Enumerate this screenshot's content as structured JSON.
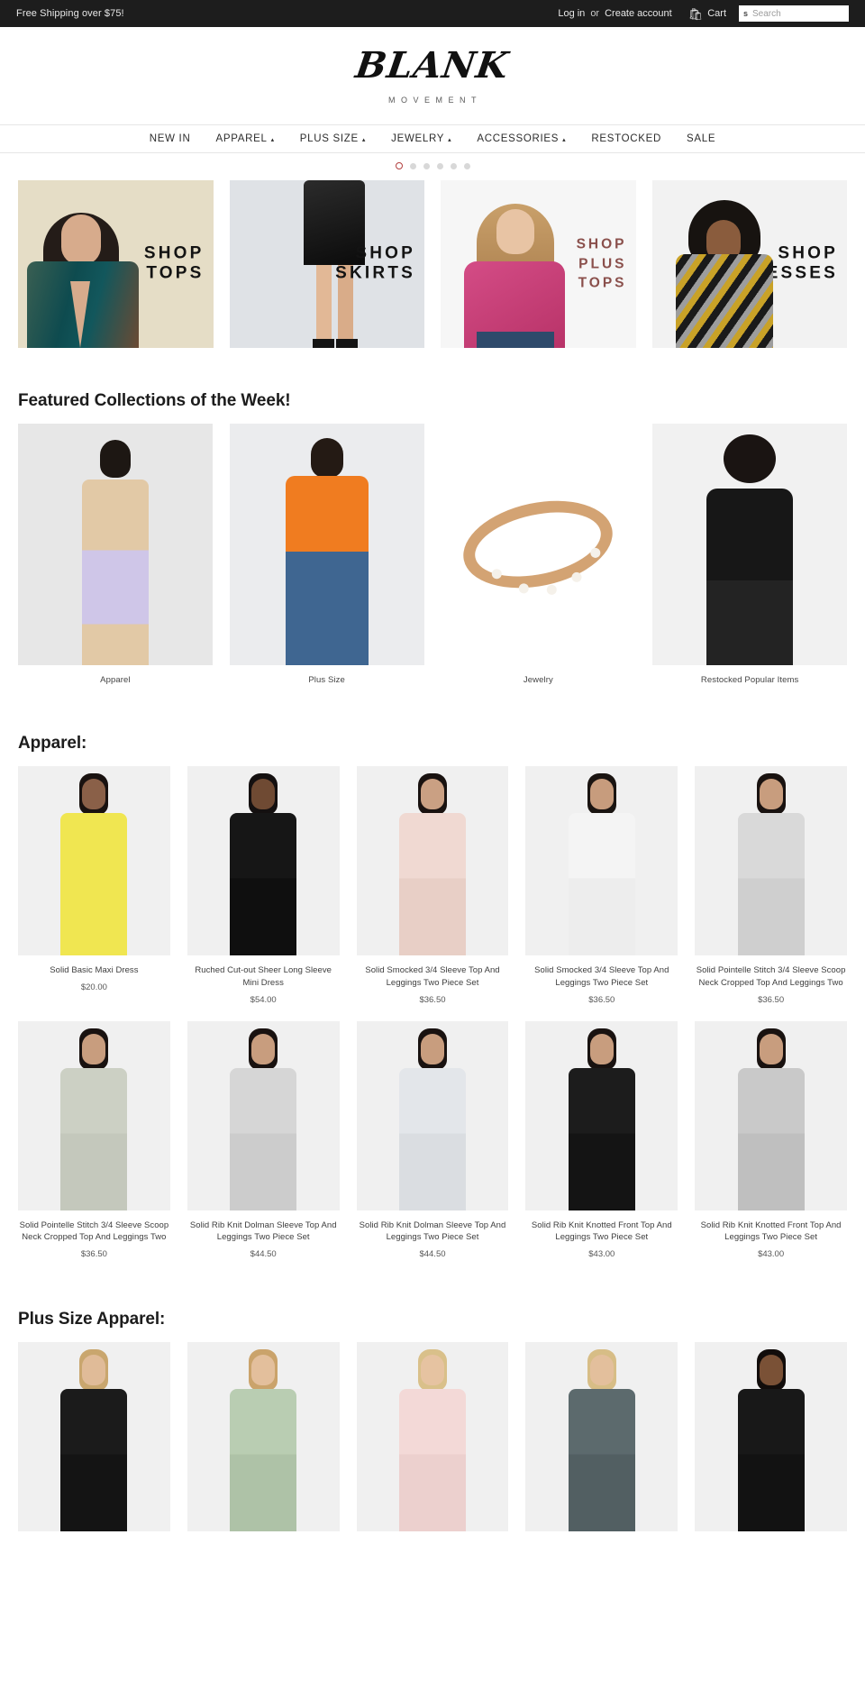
{
  "topbar": {
    "shipping": "Free Shipping over $75!",
    "login": "Log in",
    "or": "or",
    "create_account": "Create account",
    "cart_icon": "cart-icon",
    "cart": "Cart",
    "search_icon": "search-icon",
    "search_placeholder": "Search",
    "search_value": ""
  },
  "logo": {
    "mark": "BLANK",
    "sub": "MOVEMENT"
  },
  "nav": {
    "items": [
      {
        "label": "NEW IN",
        "caret": false
      },
      {
        "label": "APPAREL",
        "caret": true
      },
      {
        "label": "PLUS SIZE",
        "caret": true
      },
      {
        "label": "JEWELRY",
        "caret": true
      },
      {
        "label": "ACCESSORIES",
        "caret": true
      },
      {
        "label": "RESTOCKED",
        "caret": false
      },
      {
        "label": "SALE",
        "caret": false
      }
    ],
    "caret_glyph": "▴"
  },
  "carousel": {
    "slide_count": 6,
    "active_index": 0,
    "active_color": "#b3403f",
    "inactive_color": "#d8d8d8"
  },
  "banners": [
    {
      "line1": "SHOP",
      "line2": "TOPS",
      "line3": "",
      "text_color": "#131313",
      "bg": "#e5ddc6"
    },
    {
      "line1": "SHOP",
      "line2": "SKIRTS",
      "line3": "",
      "text_color": "#131313",
      "bg": "#dfe2e6"
    },
    {
      "line1": "SHOP",
      "line2": "PLUS",
      "line3": "TOPS",
      "text_color": "#8a4f4b",
      "bg": "#f6f6f6"
    },
    {
      "line1": "SHOP",
      "line2": "DRESSES",
      "line3": "",
      "text_color": "#131313",
      "bg": "#f2f2f2"
    }
  ],
  "featured": {
    "heading": "Featured Collections of the Week!",
    "collections": [
      {
        "label": "Apparel"
      },
      {
        "label": "Plus Size"
      },
      {
        "label": "Jewelry"
      },
      {
        "label": "Restocked Popular Items"
      }
    ]
  },
  "apparel": {
    "heading": "Apparel:",
    "products": [
      {
        "title": "Solid Basic Maxi Dress",
        "price": "$20.00",
        "c1": "#f0e651",
        "c2": "#f0e651",
        "skin": "#8a6048",
        "hair": "#191210"
      },
      {
        "title": "Ruched Cut-out Sheer Long Sleeve Mini Dress",
        "price": "$54.00",
        "c1": "#161616",
        "c2": "#0f0f0f",
        "skin": "#6f4a33",
        "hair": "#141010"
      },
      {
        "title": "Solid Smocked 3/4 Sleeve Top And Leggings Two Piece Set",
        "price": "$36.50",
        "c1": "#f0d9d2",
        "c2": "#e8cfc6",
        "skin": "#caa083",
        "hair": "#191210"
      },
      {
        "title": "Solid Smocked 3/4 Sleeve Top And Leggings Two Piece Set",
        "price": "$36.50",
        "c1": "#f4f4f4",
        "c2": "#ededed",
        "skin": "#c79c7d",
        "hair": "#1a1411"
      },
      {
        "title": "Solid Pointelle Stitch 3/4 Sleeve Scoop Neck Cropped Top And Leggings Two",
        "price": "$36.50",
        "c1": "#d9d9d9",
        "c2": "#cfcfcf",
        "skin": "#c89d7e",
        "hair": "#191210"
      },
      {
        "title": "Solid Pointelle Stitch 3/4 Sleeve Scoop Neck Cropped Top And Leggings Two",
        "price": "$36.50",
        "c1": "#ccd0c4",
        "c2": "#c4c8bc",
        "skin": "#c89d7e",
        "hair": "#191210"
      },
      {
        "title": "Solid Rib Knit Dolman Sleeve Top And Leggings Two Piece Set",
        "price": "$44.50",
        "c1": "#d6d6d6",
        "c2": "#cccccc",
        "skin": "#c89d7e",
        "hair": "#191210"
      },
      {
        "title": "Solid Rib Knit Dolman Sleeve Top And Leggings Two Piece Set",
        "price": "$44.50",
        "c1": "#e3e6ea",
        "c2": "#dadde1",
        "skin": "#c89d7e",
        "hair": "#191210"
      },
      {
        "title": "Solid Rib Knit Knotted Front Top And Leggings Two Piece Set",
        "price": "$43.00",
        "c1": "#1c1c1c",
        "c2": "#141414",
        "skin": "#c89d7e",
        "hair": "#191210"
      },
      {
        "title": "Solid Rib Knit Knotted Front Top And Leggings Two Piece Set",
        "price": "$43.00",
        "c1": "#c9c9c9",
        "c2": "#bfbfbf",
        "skin": "#c89d7e",
        "hair": "#191210"
      }
    ]
  },
  "plus_size": {
    "heading": "Plus Size Apparel:",
    "products": [
      {
        "title": "",
        "price": "",
        "c1": "#1b1b1b",
        "c2": "#141414",
        "skin": "#e0bb98",
        "hair": "#c9a66e"
      },
      {
        "title": "",
        "price": "",
        "c1": "#b9cdb2",
        "c2": "#aec2a7",
        "skin": "#e3bf9c",
        "hair": "#caa36b"
      },
      {
        "title": "",
        "price": "",
        "c1": "#f3d9d7",
        "c2": "#ecd0ce",
        "skin": "#e6c3a1",
        "hair": "#d9c08a"
      },
      {
        "title": "",
        "price": "",
        "c1": "#5c6a6d",
        "c2": "#525f62",
        "skin": "#e3bf9c",
        "hair": "#d7bd86"
      },
      {
        "title": "",
        "price": "",
        "c1": "#181818",
        "c2": "#121212",
        "skin": "#7a5136",
        "hair": "#120d0b"
      }
    ]
  }
}
